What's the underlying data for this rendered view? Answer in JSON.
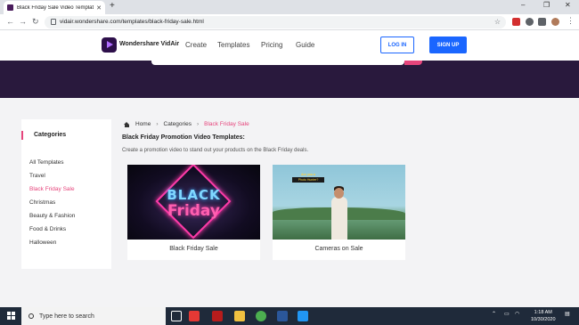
{
  "browser": {
    "tab_title": "Black Friday Sale Video Templates",
    "url": "vidair.wondershare.com/templates/black-friday-sale.html",
    "new_tab": "+",
    "minimize": "–",
    "maximize": "❐",
    "close": "✕"
  },
  "header": {
    "brand": "Wondershare VidAir",
    "nav": [
      "Create",
      "Templates",
      "Pricing",
      "Guide"
    ],
    "login": "LOG IN",
    "signup": "SIGN UP"
  },
  "sidebar": {
    "title": "Categories",
    "items": [
      "All Templates",
      "Travel",
      "Black Friday Sale",
      "Christmas",
      "Beauty & Fashion",
      "Food & Drinks",
      "Halloween"
    ],
    "active_index": 2
  },
  "breadcrumb": {
    "home": "Home",
    "categories": "Categories",
    "current": "Black Friday Sale"
  },
  "main": {
    "title": "Black Friday Promotion Video Templates:",
    "subtitle": "Create a promotion video to stand out your products on the Black Friday deals.",
    "cards": [
      {
        "caption": "Black Friday Sale",
        "thumb_line1": "BLACK",
        "thumb_line2": "Friday"
      },
      {
        "caption": "Cameras on Sale",
        "thumb_line1": "Are you a",
        "thumb_line2": "Photo Hunter?"
      }
    ]
  },
  "taskbar": {
    "search_placeholder": "Type here to search",
    "time": "1:18 AM",
    "date": "10/30/2020"
  },
  "colors": {
    "accent_pink": "#e6457c",
    "brand_blue": "#1a66ff",
    "hero_purple": "#29193d"
  }
}
